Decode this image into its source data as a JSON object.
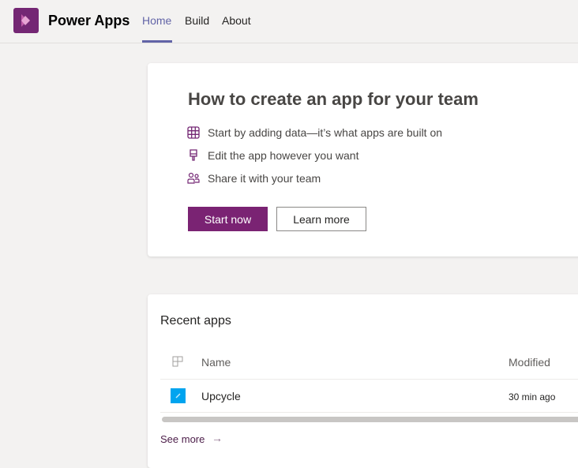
{
  "header": {
    "app_name": "Power Apps",
    "tabs": [
      {
        "label": "Home",
        "active": true
      },
      {
        "label": "Build"
      },
      {
        "label": "About"
      }
    ]
  },
  "intro": {
    "title": "How to create an app for your team",
    "steps": [
      {
        "icon": "table-icon",
        "text": "Start by adding data—it’s what apps are built on"
      },
      {
        "icon": "paintbrush-icon",
        "text": "Edit the app however you want"
      },
      {
        "icon": "people-icon",
        "text": "Share it with your team"
      }
    ],
    "start_label": "Start now",
    "learn_label": "Learn more"
  },
  "recent": {
    "title": "Recent apps",
    "columns": [
      "Name",
      "Modified"
    ],
    "rows": [
      {
        "name": "Upcycle",
        "modified": "30 min ago"
      }
    ],
    "see_more": "See more"
  },
  "colors": {
    "accent": "#742774",
    "tab_active": "#6264a7",
    "app_icon": "#00a4ef"
  }
}
